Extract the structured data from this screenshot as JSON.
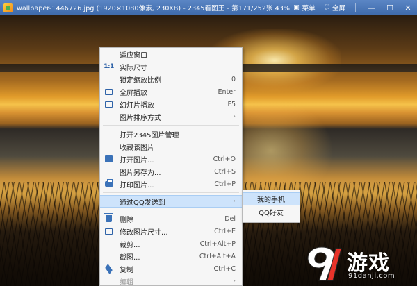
{
  "titlebar": {
    "title": "wallpaper-1446726.jpg (1920×1080像素, 230KB) - 2345看图王 - 第171/252张 43%",
    "menu_label": "菜单",
    "fullscreen_label": "全屏",
    "minimize_glyph": "—",
    "maximize_glyph": "☐",
    "close_glyph": "✕"
  },
  "context_menu": {
    "items": [
      {
        "label": "适应窗口",
        "shortcut": ""
      },
      {
        "label": "实际尺寸",
        "shortcut": "",
        "icon": "1:1"
      },
      {
        "label": "锁定缩放比例",
        "shortcut": "0"
      },
      {
        "label": "全屏播放",
        "shortcut": "Enter"
      },
      {
        "label": "幻灯片播放",
        "shortcut": "F5"
      },
      {
        "label": "图片排序方式",
        "shortcut": "",
        "arrow": "›"
      },
      {
        "label": "打开2345图片管理",
        "shortcut": ""
      },
      {
        "label": "收藏该图片",
        "shortcut": ""
      },
      {
        "label": "打开图片...",
        "shortcut": "Ctrl+O"
      },
      {
        "label": "图片另存为...",
        "shortcut": "Ctrl+S"
      },
      {
        "label": "打印图片...",
        "shortcut": "Ctrl+P"
      },
      {
        "label": "通过QQ发送到",
        "shortcut": "",
        "arrow": "›"
      },
      {
        "label": "删除",
        "shortcut": "Del"
      },
      {
        "label": "修改图片尺寸...",
        "shortcut": "Ctrl+E"
      },
      {
        "label": "裁剪...",
        "shortcut": "Ctrl+Alt+P"
      },
      {
        "label": "截图...",
        "shortcut": "Ctrl+Alt+A"
      },
      {
        "label": "复制",
        "shortcut": "Ctrl+C"
      },
      {
        "label": "编辑",
        "shortcut": "",
        "arrow": "›"
      }
    ]
  },
  "submenu": {
    "items": [
      {
        "label": "我的手机"
      },
      {
        "label": "QQ好友"
      }
    ]
  },
  "watermark": {
    "logo_glyph": "9l",
    "text": "游戏",
    "url": "91danji.com"
  },
  "colors": {
    "titlebar": "#4a76b8",
    "menu_bg": "#f6f6f6",
    "highlight": "#cde3fb",
    "icon_blue": "#3b72b8"
  }
}
